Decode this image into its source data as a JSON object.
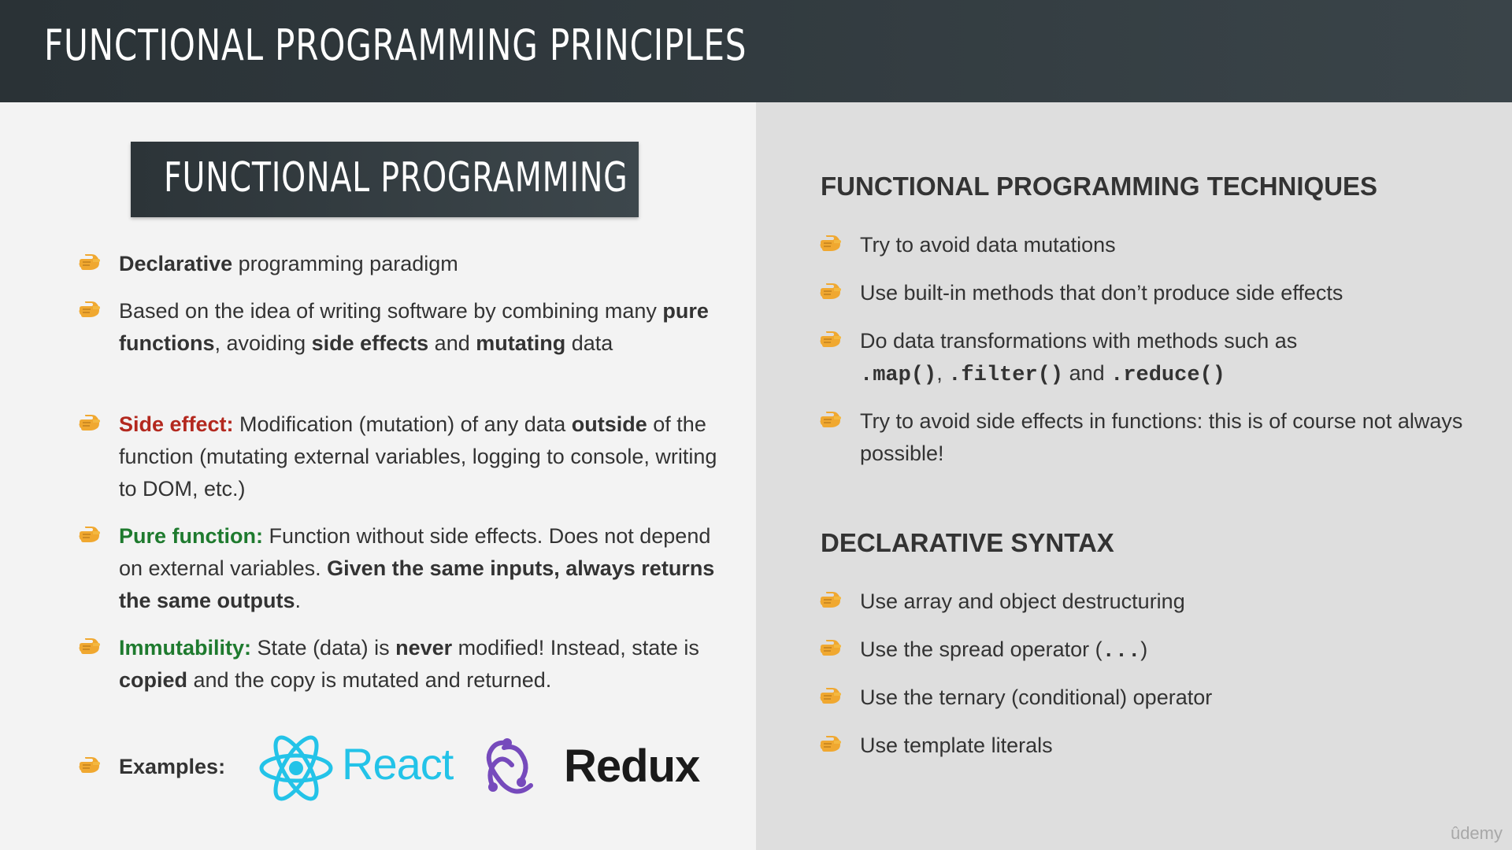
{
  "header": {
    "title": "FUNCTIONAL PROGRAMMING PRINCIPLES"
  },
  "left": {
    "box_title": "FUNCTIONAL PROGRAMMING",
    "b1": {
      "bold": "Declarative",
      "rest": " programming paradigm"
    },
    "b2": {
      "t1": "Based on the idea of writing software by combining many ",
      "bold1": "pure functions",
      "t2": ", avoiding ",
      "bold2": "side effects",
      "t3": " and ",
      "bold3": "mutating",
      "t4": " data"
    },
    "b3": {
      "label": "Side effect:",
      "t1": " Modification (mutation) of any data ",
      "bold1": "outside",
      "t2": " of the function (mutating external variables, logging to console, writing to DOM, etc.)"
    },
    "b4": {
      "label": "Pure function:",
      "t1": " Function without side effects. Does not depend on external variables. ",
      "bold1": "Given the same inputs, always returns the same outputs",
      "t2": "."
    },
    "b5": {
      "label": "Immutability:",
      "t1": " State (data) is ",
      "bold1": "never",
      "t2": " modified! Instead, state is ",
      "bold2": "copied",
      "t3": " and the copy is mutated and returned."
    },
    "examples": {
      "label": "Examples:",
      "react": "React",
      "redux": "Redux"
    }
  },
  "right": {
    "techniques_heading": "FUNCTIONAL PROGRAMMING TECHNIQUES",
    "t1": "Try to avoid data mutations",
    "t2": "Use built-in methods that don’t produce side effects",
    "t3": {
      "text": "Do data transformations with methods such as ",
      "m1": ".map()",
      "sep": ", ",
      "m2": ".filter()",
      "and": " and ",
      "m3": ".reduce()"
    },
    "t4": "Try to avoid side effects in functions: this is of course not always possible!",
    "declarative_heading": "DECLARATIVE SYNTAX",
    "d1": "Use array and object destructuring",
    "d2": {
      "text": "Use the spread operator (",
      "mono": "...",
      "close": ")"
    },
    "d3": "Use the ternary (conditional) operator",
    "d4": "Use template literals"
  },
  "watermark": "ûdemy",
  "colors": {
    "header_bg": "#2f383c",
    "red_accent": "#b3281e",
    "green_accent": "#1e7a2e",
    "react_blue": "#23c3e8",
    "redux_purple": "#764abc",
    "hand_icon": "#f0a830"
  }
}
